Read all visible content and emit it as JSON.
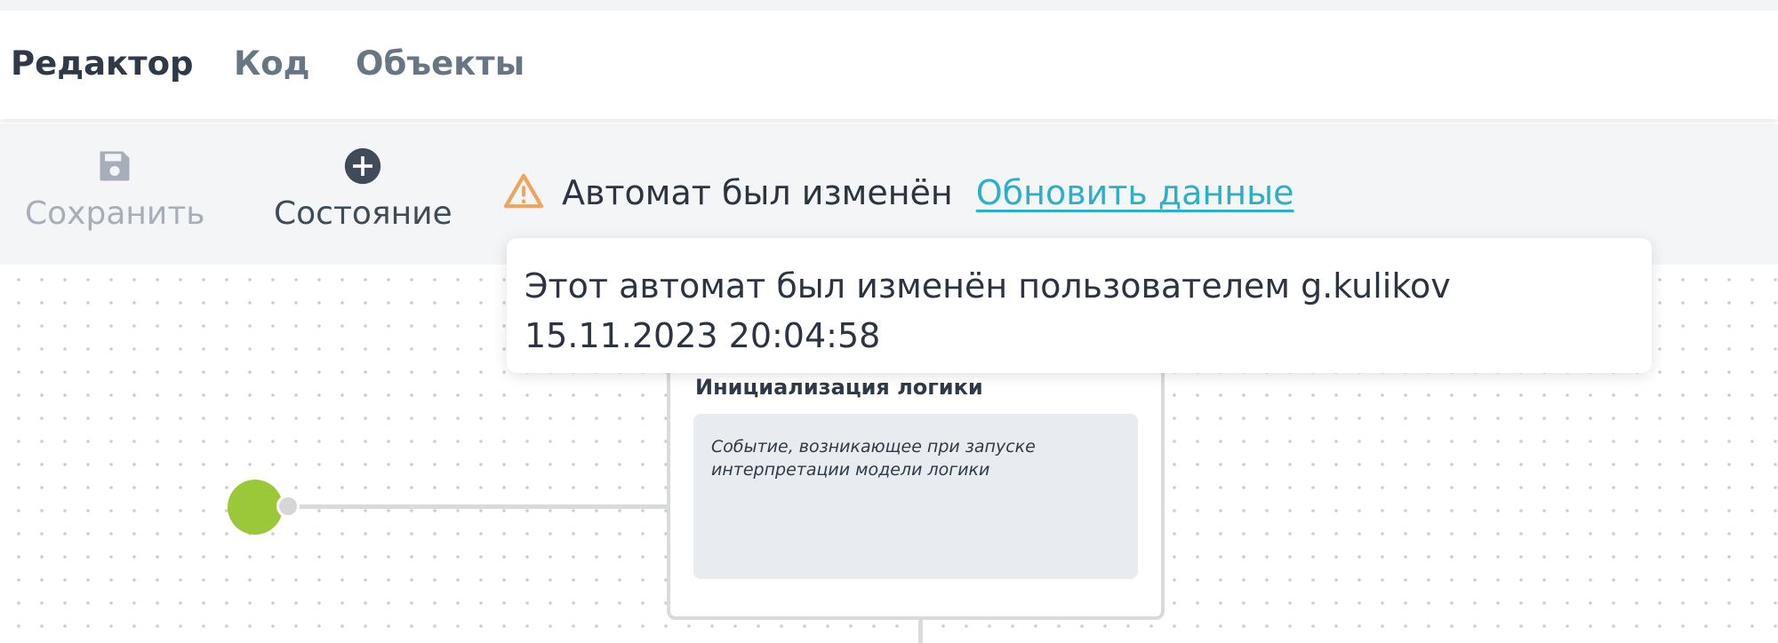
{
  "tabs": [
    {
      "label": "Редактор",
      "active": true
    },
    {
      "label": "Код",
      "active": false
    },
    {
      "label": "Объекты",
      "active": false
    }
  ],
  "toolbar": {
    "save_label": "Сохранить",
    "save_icon": "floppy-disk-icon",
    "save_enabled": false,
    "state_label": "Состояние",
    "state_icon": "plus-circle-icon"
  },
  "notice": {
    "icon": "warning-triangle-icon",
    "text": "Автомат был изменён",
    "link": "Обновить данные",
    "tooltip": "Этот автомат был изменён пользователем g.kulikov 15.11.2023 20:04:58"
  },
  "diagram": {
    "initial_node_color": "#9bc838",
    "state": {
      "title": "Инициализация логики",
      "event_description": "Событие, возникающее при запуске интерпретации модели логики"
    }
  },
  "colors": {
    "link": "#2cafc9",
    "warning": "#f0a35a",
    "tab_active": "#2f3a48",
    "tab_inactive": "#677685"
  }
}
